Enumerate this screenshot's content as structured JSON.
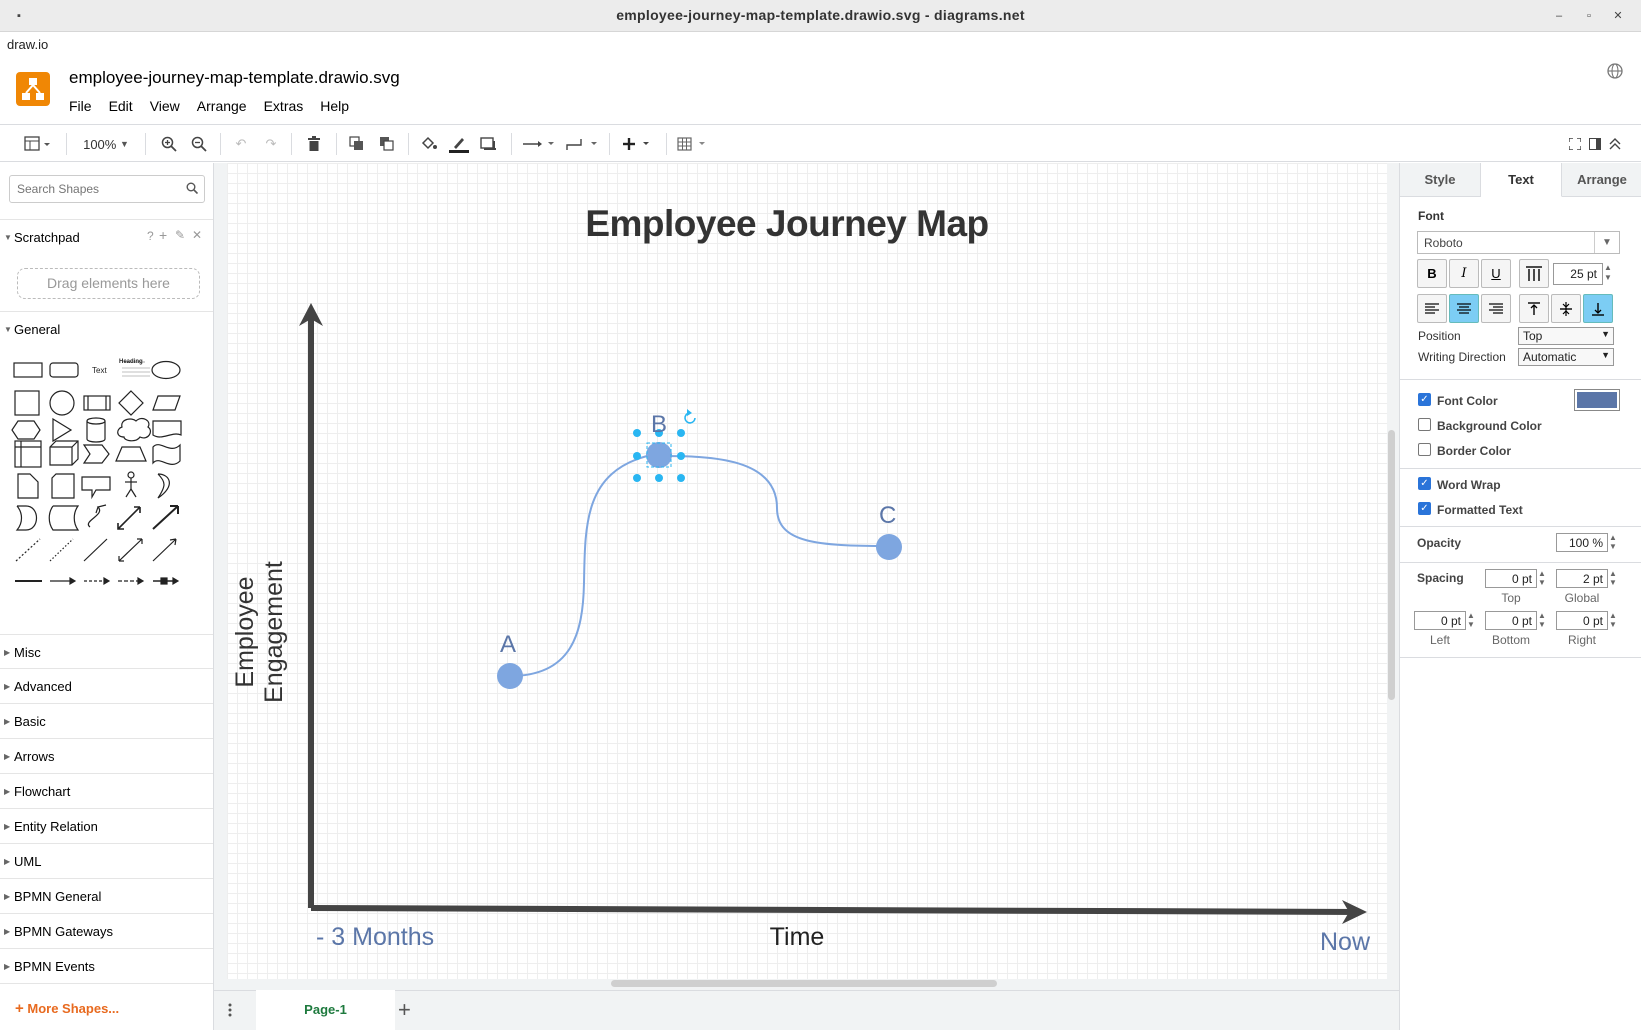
{
  "window": {
    "title": "employee-journey-map-template.drawio.svg - diagrams.net",
    "app_menu": "draw.io"
  },
  "header": {
    "doc_title": "employee-journey-map-template.drawio.svg",
    "menus": [
      "File",
      "Edit",
      "View",
      "Arrange",
      "Extras",
      "Help"
    ]
  },
  "toolbar": {
    "zoom": "100%"
  },
  "sidebar": {
    "search_placeholder": "Search Shapes",
    "scratchpad": "Scratchpad",
    "drag_hint": "Drag elements here",
    "general": "General",
    "shape_text_label": "Text",
    "sections": [
      "Misc",
      "Advanced",
      "Basic",
      "Arrows",
      "Flowchart",
      "Entity Relation",
      "UML",
      "BPMN General",
      "BPMN Gateways",
      "BPMN Events"
    ],
    "more_shapes": "More Shapes..."
  },
  "diagram": {
    "title": "Employee Journey Map",
    "y_axis_label": "Employee Engagement",
    "x_axis_label": "Time",
    "x_start_label": "- 3 Months",
    "x_end_label": "Now",
    "points": [
      {
        "label": "A"
      },
      {
        "label": "B"
      },
      {
        "label": "C"
      }
    ],
    "accent_color": "#7ea6e0",
    "label_color": "#5b76a8"
  },
  "pages": {
    "current": "Page-1"
  },
  "panel": {
    "tabs": [
      "Style",
      "Text",
      "Arrange"
    ],
    "active_tab": "Text",
    "font_label": "Font",
    "font_value": "Roboto",
    "font_size": "25 pt",
    "bold": "B",
    "italic": "I",
    "underline": "U",
    "position_label": "Position",
    "position_value": "Top",
    "writing_direction_label": "Writing Direction",
    "writing_direction_value": "Automatic",
    "font_color_label": "Font Color",
    "font_color_checked": true,
    "font_color_swatch": "#5b76a8",
    "background_color_label": "Background Color",
    "border_color_label": "Border Color",
    "word_wrap_label": "Word Wrap",
    "formatted_text_label": "Formatted Text",
    "opacity_label": "Opacity",
    "opacity_value": "100 %",
    "spacing_label": "Spacing",
    "spacing_top": "0 pt",
    "spacing_global": "2 pt",
    "spacing_left": "0 pt",
    "spacing_bottom": "0 pt",
    "spacing_right": "0 pt",
    "top_caption": "Top",
    "global_caption": "Global",
    "left_caption": "Left",
    "bottom_caption": "Bottom",
    "right_caption": "Right"
  }
}
